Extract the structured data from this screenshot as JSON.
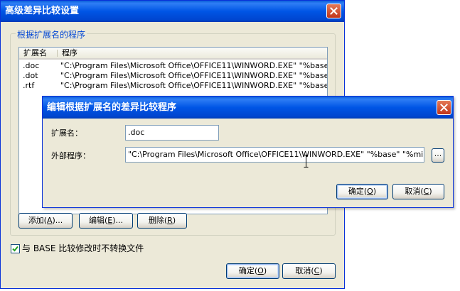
{
  "outer_dialog": {
    "title": "高级差异比较设置",
    "group_title": "根据扩展名的程序",
    "list": {
      "columns": [
        "扩展名",
        "程序"
      ],
      "rows": [
        {
          "ext": ".doc",
          "program": "\"C:\\Program Files\\Microsoft Office\\OFFICE11\\WINWORD.EXE\" \"%base\" \"..."
        },
        {
          "ext": ".dot",
          "program": "\"C:\\Program Files\\Microsoft Office\\OFFICE11\\WINWORD.EXE\" \"%base\" \"..."
        },
        {
          "ext": ".rtf",
          "program": "\"C:\\Program Files\\Microsoft Office\\OFFICE11\\WINWORD.EXE\" \"%base\" \"..."
        }
      ]
    },
    "buttons": {
      "add": {
        "text": "添加(",
        "key": "A",
        "tail": ")..."
      },
      "edit": {
        "text": "编辑(",
        "key": "E",
        "tail": ")..."
      },
      "delete": {
        "text": "删除(",
        "key": "R",
        "tail": ")"
      },
      "ok": {
        "text": "确定(",
        "key": "O",
        "tail": ")"
      },
      "cancel": {
        "text": "取消(",
        "key": "C",
        "tail": ")"
      }
    },
    "checkbox_label": "与 BASE 比较修改时不转换文件",
    "checkbox_checked": true
  },
  "inner_dialog": {
    "title": "编辑根据扩展名的差异比较程序",
    "ext_label": "扩展名：",
    "ext_value": ".doc",
    "program_label": "外部程序：",
    "program_value": "\"C:\\Program Files\\Microsoft Office\\OFFICE11\\WINWORD.EXE\" \"%base\" \"%mine\" /w /r",
    "browse_label": "...",
    "buttons": {
      "ok": {
        "text": "确定(",
        "key": "O",
        "tail": ")"
      },
      "cancel": {
        "text": "取消(",
        "key": "C",
        "tail": ")"
      }
    }
  },
  "icons": [
    "close-icon",
    "checkmark-icon",
    "text-cursor-icon"
  ],
  "colors": {
    "title_bar": "#0055e5",
    "close_button": "#d4502b",
    "dialog_bg": "#ece9d8",
    "group_title": "#0046d5"
  }
}
